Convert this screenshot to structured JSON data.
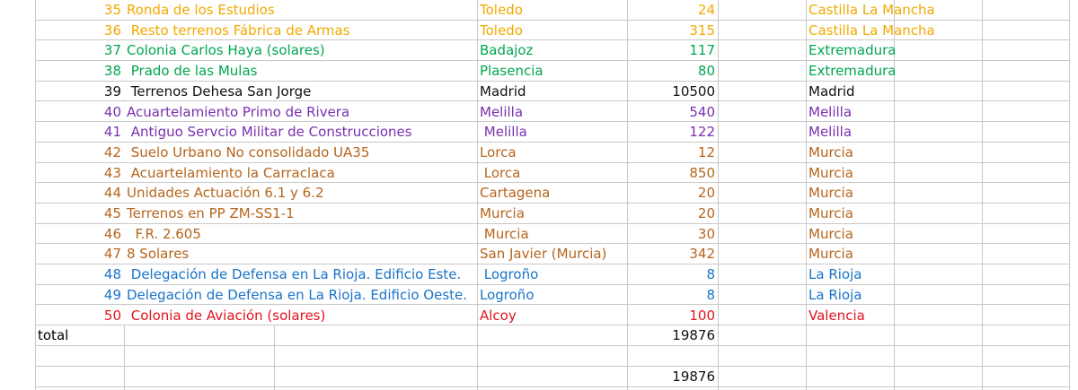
{
  "rows": [
    {
      "n": "35",
      "name": "Ronda de los Estudios",
      "city": "Toledo",
      "qty": "24",
      "region": "Castilla La Mancha",
      "color": "yellow"
    },
    {
      "n": "36",
      "name": " Resto terrenos Fábrica de Armas",
      "city": "Toledo",
      "qty": "315",
      "region": "Castilla La Mancha",
      "color": "yellow"
    },
    {
      "n": "37",
      "name": "Colonia Carlos Haya (solares)",
      "city": "Badajoz",
      "qty": "117",
      "region": "Extremadura",
      "color": "green"
    },
    {
      "n": "38",
      "name": " Prado de las Mulas",
      "city": "Plasencia",
      "qty": "80",
      "region": "Extremadura",
      "color": "green"
    },
    {
      "n": "39",
      "name": " Terrenos Dehesa San Jorge",
      "city": "Madrid",
      "qty": "10500",
      "region": "Madrid",
      "color": "black"
    },
    {
      "n": "40",
      "name": "Acuartelamiento Primo de Rivera",
      "city": "Melilla",
      "qty": "540",
      "region": "Melilla",
      "color": "purple"
    },
    {
      "n": "41",
      "name": " Antiguo Servcio Militar de Construcciones",
      "city": " Melilla",
      "qty": "122",
      "region": "Melilla",
      "color": "purple"
    },
    {
      "n": "42",
      "name": " Suelo Urbano No consolidado UA35",
      "city": "Lorca",
      "qty": "12",
      "region": "Murcia",
      "color": "brown"
    },
    {
      "n": "43",
      "name": " Acuartelamiento la Carraclaca",
      "city": " Lorca",
      "qty": "850",
      "region": "Murcia",
      "color": "brown"
    },
    {
      "n": "44",
      "name": "Unidades Actuación 6.1 y 6.2",
      "city": "Cartagena",
      "qty": "20",
      "region": "Murcia",
      "color": "brown"
    },
    {
      "n": "45",
      "name": "Terrenos en PP ZM-SS1-1",
      "city": "Murcia",
      "qty": "20",
      "region": "Murcia",
      "color": "brown"
    },
    {
      "n": "46",
      "name": "  F.R. 2.605",
      "city": " Murcia",
      "qty": "30",
      "region": "Murcia",
      "color": "brown"
    },
    {
      "n": "47",
      "name": "8 Solares",
      "city": "San Javier (Murcia)",
      "qty": "342",
      "region": "Murcia",
      "color": "brown"
    },
    {
      "n": "48",
      "name": " Delegación de Defensa en La Rioja. Edificio Este.",
      "city": " Logroño",
      "qty": "8",
      "region": "La Rioja",
      "color": "blue"
    },
    {
      "n": "49",
      "name": "Delegación de Defensa en La Rioja. Edificio Oeste.",
      "city": "Logroño",
      "qty": "8",
      "region": "La Rioja",
      "color": "blue"
    },
    {
      "n": "50",
      "name": " Colonia de Aviación (solares)",
      "city": "Alcoy",
      "qty": "100",
      "region": "Valencia",
      "color": "red"
    }
  ],
  "total_label": "total",
  "total_value": "19876",
  "sum_value": "19876",
  "colors": {
    "yellow": "#f2a900",
    "green": "#00a64f",
    "black": "#111111",
    "purple": "#7a2fb0",
    "brown": "#b5651d",
    "blue": "#1a73c8",
    "red": "#e0141e"
  }
}
